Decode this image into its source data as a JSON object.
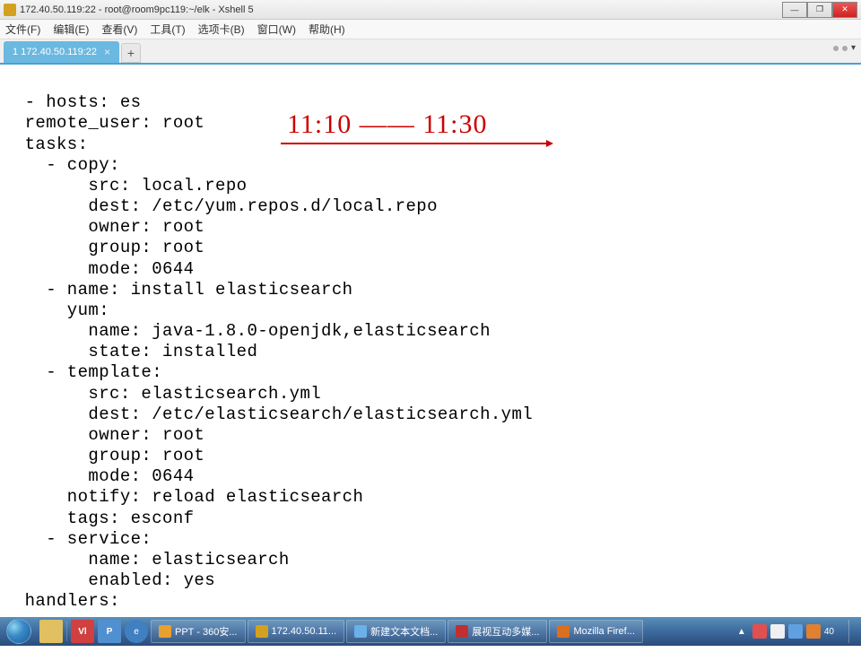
{
  "window": {
    "title": "172.40.50.119:22 - root@room9pc119:~/elk - Xshell 5"
  },
  "menus": {
    "file": "文件(F)",
    "edit": "编辑(E)",
    "view": "查看(V)",
    "tools": "工具(T)",
    "tabs": "选项卡(B)",
    "window": "窗口(W)",
    "help": "帮助(H)"
  },
  "tab": {
    "label": "1 172.40.50.119:22"
  },
  "terminal_text": "- hosts: es\n  remote_user: root\n  tasks:\n    - copy:\n        src: local.repo\n        dest: /etc/yum.repos.d/local.repo\n        owner: root\n        group: root\n        mode: 0644\n    - name: install elasticsearch\n      yum:\n        name: java-1.8.0-openjdk,elasticsearch\n        state: installed\n    - template:\n        src: elasticsearch.yml\n        dest: /etc/elasticsearch/elasticsearch.yml\n        owner: root\n        group: root\n        mode: 0644\n      notify: reload elasticsearch\n      tags: esconf\n    - service:\n        name: elasticsearch\n        enabled: yes\n  handlers:",
  "annotation": "11:10 —— 11:30",
  "taskbar": {
    "items": [
      {
        "label": "PPT - 360安...",
        "color": "#e8a030"
      },
      {
        "label": "172.40.50.11...",
        "color": "#d4a020"
      },
      {
        "label": "新建文本文档...",
        "color": "#6bb0e8"
      },
      {
        "label": "展视互动多媒...",
        "color": "#c03030"
      },
      {
        "label": "Mozilla Firef...",
        "color": "#d87020"
      }
    ],
    "tray_label": "40",
    "clock": ""
  },
  "icons": {
    "pin_char": "📌",
    "vlc_char": "Vl",
    "p_char": "P",
    "ie_char": "e"
  }
}
